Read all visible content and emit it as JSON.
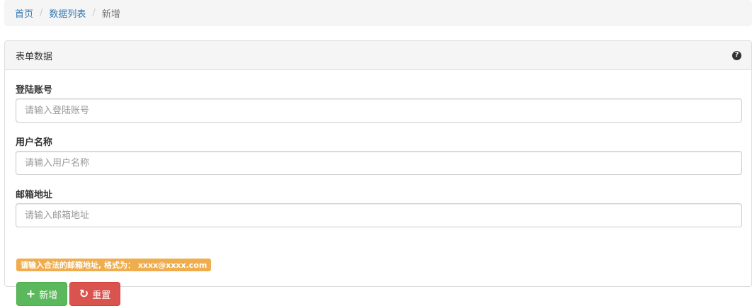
{
  "breadcrumb": {
    "items": [
      "首页",
      "数据列表"
    ],
    "separator": "/",
    "active": "新增"
  },
  "panel": {
    "title": "表单数据",
    "help_icon": "question-circle-icon"
  },
  "form": {
    "fields": [
      {
        "label": "登陆账号",
        "placeholder": "请输入登陆账号",
        "value": ""
      },
      {
        "label": "用户名称",
        "placeholder": "请输入用户名称",
        "value": ""
      },
      {
        "label": "邮箱地址",
        "placeholder": "请输入邮箱地址",
        "value": ""
      }
    ],
    "email_hint": "请输入合法的邮箱地址, 格式为： xxxx@xxxx.com"
  },
  "buttons": {
    "add": {
      "icon": "plus-icon",
      "label": "新增",
      "color": "#5cb85c"
    },
    "reset": {
      "icon": "refresh-icon",
      "label": "重置",
      "color": "#d9534f"
    }
  },
  "colors": {
    "link": "#337ab7",
    "hint": "#f0ad4e"
  }
}
